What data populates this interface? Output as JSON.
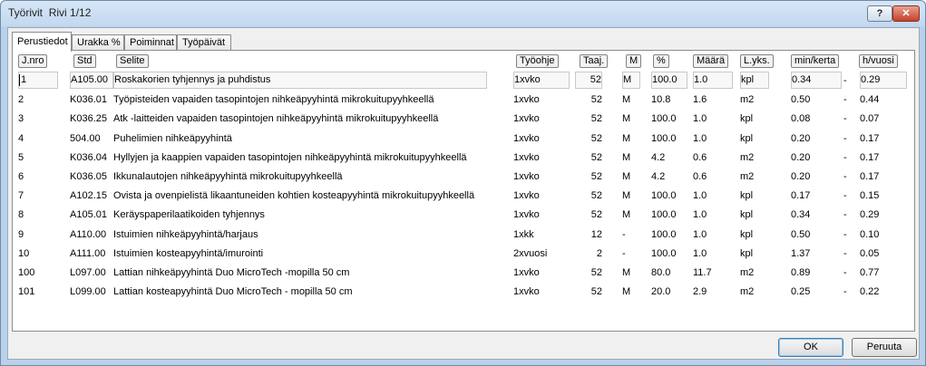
{
  "window": {
    "title": "Työrivit",
    "row_indicator": "Rivi 1/12",
    "help_label": "?",
    "close_label": "✕"
  },
  "tabs": [
    "Perustiedot",
    "Urakka %",
    "Poiminnat",
    "Työpäivät"
  ],
  "columns": {
    "jnro": "J.nro",
    "std": "Std",
    "selite": "Selite",
    "tyoohje": "Työohje",
    "taaj": "Taaj.",
    "m": "M",
    "pct": "%",
    "maara": "Määrä",
    "lyks": "L.yks.",
    "minkerta": "min/kerta",
    "hvuosi": "h/vuosi"
  },
  "rows": [
    {
      "jnro": "1",
      "std": "A105.00",
      "selite": "Roskakorien tyhjennys ja puhdistus",
      "tyoohje": "1xvko",
      "taaj": "52",
      "m": "M",
      "pct": "100.0",
      "maara": "1.0",
      "lyks": "kpl",
      "minkerta": "0.34",
      "dash": "-",
      "hvuosi": "0.29"
    },
    {
      "jnro": "2",
      "std": "K036.01",
      "selite": "Työpisteiden vapaiden tasopintojen nihkeäpyyhintä mikrokuitupyyhkeellä",
      "tyoohje": "1xvko",
      "taaj": "52",
      "m": "M",
      "pct": "10.8",
      "maara": "1.6",
      "lyks": "m2",
      "minkerta": "0.50",
      "dash": "-",
      "hvuosi": "0.44"
    },
    {
      "jnro": "3",
      "std": "K036.25",
      "selite": "Atk -laitteiden vapaiden tasopintojen nihkeäpyyhintä mikrokuitupyyhkeellä",
      "tyoohje": "1xvko",
      "taaj": "52",
      "m": "M",
      "pct": "100.0",
      "maara": "1.0",
      "lyks": "kpl",
      "minkerta": "0.08",
      "dash": "-",
      "hvuosi": "0.07"
    },
    {
      "jnro": "4",
      "std": "504.00",
      "selite": "Puhelimien nihkeäpyyhintä",
      "tyoohje": "1xvko",
      "taaj": "52",
      "m": "M",
      "pct": "100.0",
      "maara": "1.0",
      "lyks": "kpl",
      "minkerta": "0.20",
      "dash": "-",
      "hvuosi": "0.17"
    },
    {
      "jnro": "5",
      "std": "K036.04",
      "selite": "Hyllyjen ja kaappien vapaiden tasopintojen nihkeäpyyhintä mikrokuitupyyhkeellä",
      "tyoohje": "1xvko",
      "taaj": "52",
      "m": "M",
      "pct": "4.2",
      "maara": "0.6",
      "lyks": "m2",
      "minkerta": "0.20",
      "dash": "-",
      "hvuosi": "0.17"
    },
    {
      "jnro": "6",
      "std": "K036.05",
      "selite": "Ikkunalautojen nihkeäpyyhintä mikrokuitupyyhkeellä",
      "tyoohje": "1xvko",
      "taaj": "52",
      "m": "M",
      "pct": "4.2",
      "maara": "0.6",
      "lyks": "m2",
      "minkerta": "0.20",
      "dash": "-",
      "hvuosi": "0.17"
    },
    {
      "jnro": "7",
      "std": "A102.15",
      "selite": "Ovista ja ovenpielistä likaantuneiden kohtien kosteapyyhintä mikrokuitupyyhkeellä",
      "tyoohje": "1xvko",
      "taaj": "52",
      "m": "M",
      "pct": "100.0",
      "maara": "1.0",
      "lyks": "kpl",
      "minkerta": "0.17",
      "dash": "-",
      "hvuosi": "0.15"
    },
    {
      "jnro": "8",
      "std": "A105.01",
      "selite": "Keräyspaperilaatikoiden tyhjennys",
      "tyoohje": "1xvko",
      "taaj": "52",
      "m": "M",
      "pct": "100.0",
      "maara": "1.0",
      "lyks": "kpl",
      "minkerta": "0.34",
      "dash": "-",
      "hvuosi": "0.29"
    },
    {
      "jnro": "9",
      "std": "A110.00",
      "selite": "Istuimien nihkeäpyyhintä/harjaus",
      "tyoohje": "1xkk",
      "taaj": "12",
      "m": "-",
      "pct": "100.0",
      "maara": "1.0",
      "lyks": "kpl",
      "minkerta": "0.50",
      "dash": "-",
      "hvuosi": "0.10"
    },
    {
      "jnro": "10",
      "std": "A111.00",
      "selite": "Istuimien kosteapyyhintä/imurointi",
      "tyoohje": "2xvuosi",
      "taaj": "2",
      "m": "-",
      "pct": "100.0",
      "maara": "1.0",
      "lyks": "kpl",
      "minkerta": "1.37",
      "dash": "-",
      "hvuosi": "0.05"
    },
    {
      "jnro": "100",
      "std": "L097.00",
      "selite": "Lattian nihkeäpyyhintä Duo MicroTech -mopilla 50 cm",
      "tyoohje": "1xvko",
      "taaj": "52",
      "m": "M",
      "pct": "80.0",
      "maara": "11.7",
      "lyks": "m2",
      "minkerta": "0.89",
      "dash": "-",
      "hvuosi": "0.77"
    },
    {
      "jnro": "101",
      "std": "L099.00",
      "selite": "Lattian kosteapyyhintä Duo MicroTech - mopilla 50 cm",
      "tyoohje": "1xvko",
      "taaj": "52",
      "m": "M",
      "pct": "20.0",
      "maara": "2.9",
      "lyks": "m2",
      "minkerta": "0.25",
      "dash": "-",
      "hvuosi": "0.22"
    }
  ],
  "buttons": {
    "ok": "OK",
    "cancel": "Peruuta"
  }
}
